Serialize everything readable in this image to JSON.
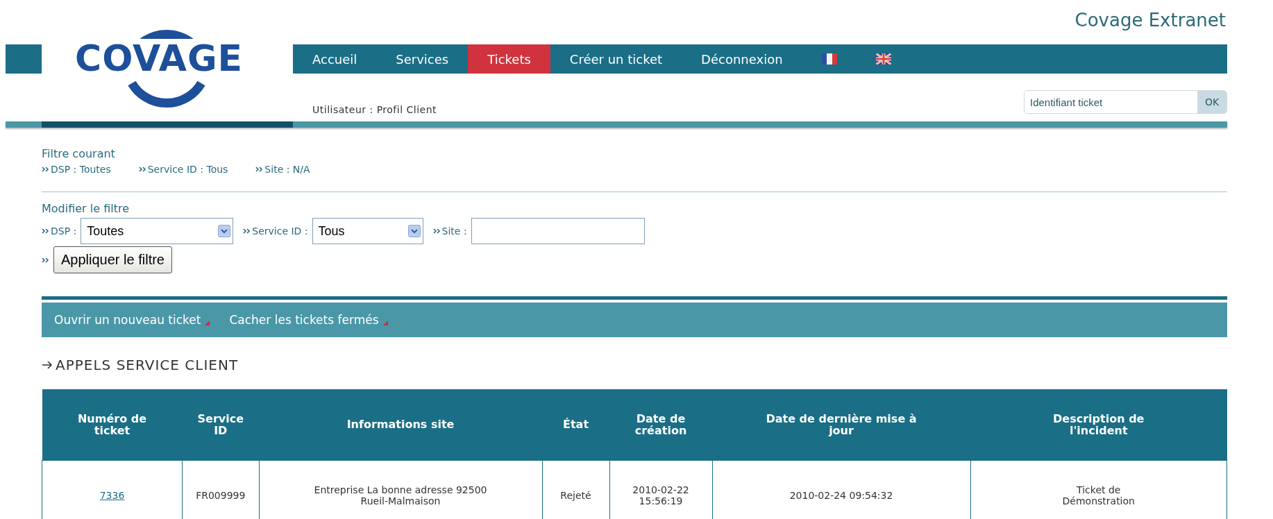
{
  "header": {
    "title": "Covage Extranet",
    "logo": "COVAGE"
  },
  "nav": {
    "items": [
      {
        "kind": "text",
        "label": "Accueil",
        "selected": false
      },
      {
        "kind": "text",
        "label": "Services",
        "selected": false
      },
      {
        "kind": "text",
        "label": "Tickets",
        "selected": true
      },
      {
        "kind": "text",
        "label": "Créer un ticket",
        "selected": false
      },
      {
        "kind": "text",
        "label": "Déconnexion",
        "selected": false
      },
      {
        "kind": "fr_flag"
      },
      {
        "kind": "uk_flag"
      }
    ]
  },
  "user_line": "Utilisateur : Profil Client",
  "ticket_search": {
    "placeholder": "Identifiant ticket",
    "button": "OK"
  },
  "current_filter": {
    "title": "Filtre courant",
    "items": [
      "DSP : Toutes",
      "Service ID : Tous",
      "Site : N/A"
    ]
  },
  "filter_form": {
    "title": "Modifier le filtre",
    "fields": [
      {
        "kind": "select",
        "label": "DSP :",
        "value": "Toutes"
      },
      {
        "kind": "select",
        "label": "Service ID :",
        "value": "Tous"
      },
      {
        "kind": "text",
        "label": "Site :"
      }
    ],
    "apply_button": "Appliquer le filtre"
  },
  "actions": [
    "Ouvrir un nouveau ticket",
    "Cacher les tickets fermés"
  ],
  "section_title": "APPELS SERVICE CLIENT",
  "table": {
    "columns": [
      "Numéro de ticket",
      "Service ID",
      "Informations site",
      "État",
      "Date de création",
      "Date de dernière mise à jour",
      "Description de l'incident"
    ],
    "rows": [
      [
        "7336",
        "FR009999",
        "Entreprise La bonne adresse 92500 Rueil-Malmaison",
        "Rejeté",
        "2010-02-22 15:56:19",
        "2010-02-24 09:54:32",
        "Ticket de Démonstration"
      ]
    ]
  }
}
